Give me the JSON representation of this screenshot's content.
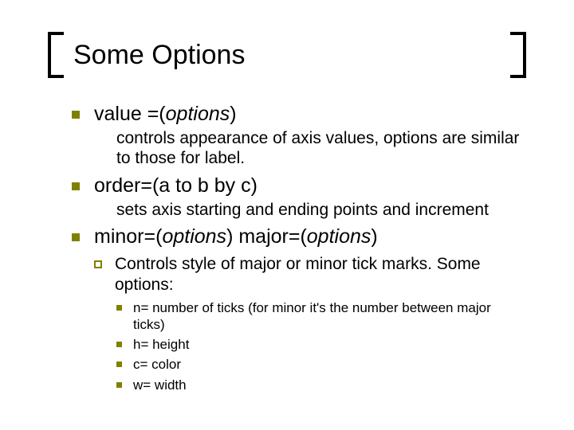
{
  "title": "Some Options",
  "items": [
    {
      "head_a": "value =(",
      "head_i": "options",
      "head_b": ")",
      "desc": "controls appearance of axis values, options are similar to those for label."
    },
    {
      "head_a": "order=(a to b by c)",
      "head_i": "",
      "head_b": "",
      "desc": "sets axis starting and ending points and increment"
    },
    {
      "head_a": "minor=(",
      "head_i": "options",
      "head_b": ") major=(",
      "head_i2": "options",
      "head_c": ")",
      "sub": {
        "text": "Controls style of major or minor tick marks. Some options:",
        "opts": [
          "n=  number of ticks (for minor it's the number between major ticks)",
          "h=  height",
          "c=  color",
          "w=  width"
        ]
      }
    }
  ]
}
